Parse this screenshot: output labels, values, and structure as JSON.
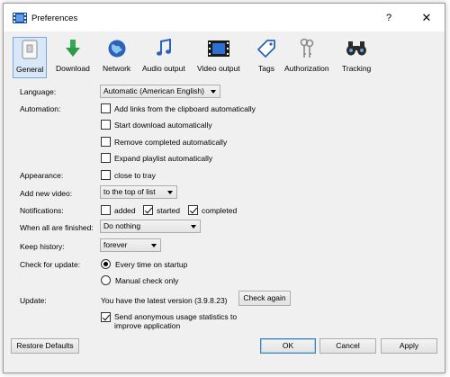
{
  "window": {
    "title": "Preferences",
    "help": "?",
    "close": "✕"
  },
  "toolbar": {
    "items": [
      {
        "label": "General",
        "icon": "general-icon"
      },
      {
        "label": "Download",
        "icon": "download-arrow-icon"
      },
      {
        "label": "Network",
        "icon": "globe-icon"
      },
      {
        "label": "Audio output",
        "icon": "music-note-icon"
      },
      {
        "label": "Video output",
        "icon": "film-icon"
      },
      {
        "label": "Tags",
        "icon": "tag-icon"
      },
      {
        "label": "Authorization",
        "icon": "keys-icon"
      },
      {
        "label": "Tracking",
        "icon": "binoculars-icon"
      }
    ]
  },
  "general": {
    "language": {
      "label": "Language:",
      "value": "Automatic (American English)"
    },
    "automation": {
      "label": "Automation:",
      "options": [
        {
          "text": "Add links from the clipboard automatically",
          "checked": false
        },
        {
          "text": "Start download automatically",
          "checked": false
        },
        {
          "text": "Remove completed automatically",
          "checked": false
        },
        {
          "text": "Expand playlist automatically",
          "checked": false
        }
      ]
    },
    "appearance": {
      "label": "Appearance:",
      "option": "close to tray",
      "checked": false
    },
    "add_new_video": {
      "label": "Add new video:",
      "value": "to the top of list"
    },
    "notifications": {
      "label": "Notifications:",
      "options": [
        {
          "text": "added",
          "checked": false
        },
        {
          "text": "started",
          "checked": true
        },
        {
          "text": "completed",
          "checked": true
        }
      ]
    },
    "when_finished": {
      "label": "When all are finished:",
      "value": "Do nothing"
    },
    "keep_history": {
      "label": "Keep history:",
      "value": "forever"
    },
    "check_update": {
      "label": "Check for update:",
      "options": [
        {
          "text": "Every time on startup",
          "checked": true
        },
        {
          "text": "Manual check only",
          "checked": false
        }
      ]
    },
    "update": {
      "label": "Update:",
      "status": "You have the latest version (3.9.8.23)",
      "check_again": "Check again"
    },
    "anonymous_stats": {
      "line1": "Send anonymous usage statistics to",
      "line2": "improve application",
      "checked": true
    }
  },
  "footer": {
    "restore": "Restore Defaults",
    "ok": "OK",
    "cancel": "Cancel",
    "apply": "Apply"
  }
}
